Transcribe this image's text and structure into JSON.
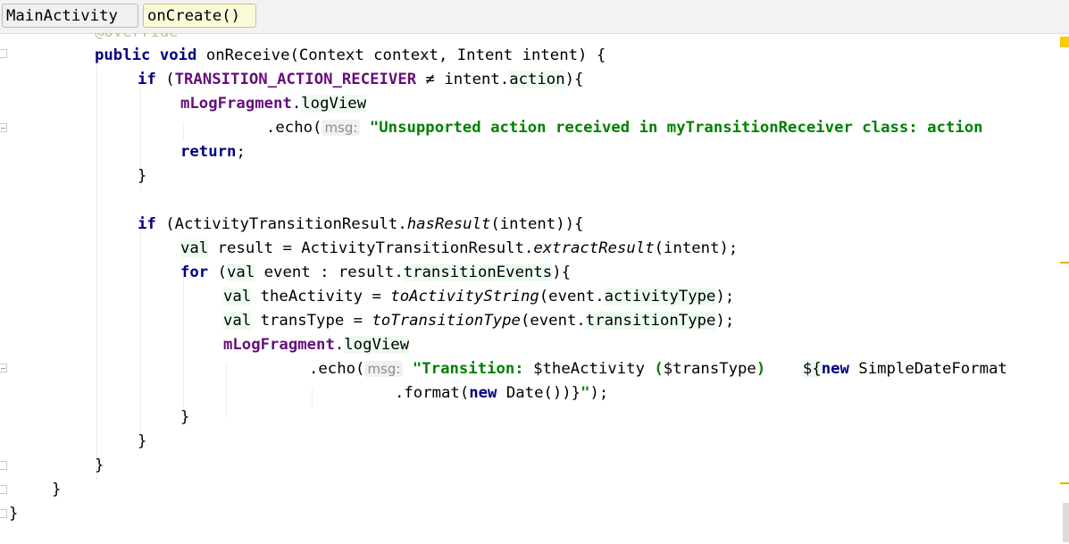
{
  "breadcrumb": {
    "items": [
      {
        "label": "MainActivity"
      },
      {
        "label": "onCreate()"
      }
    ]
  },
  "editor": {
    "override_text": "@Override",
    "lines": {
      "l1": {
        "kw1": "public void",
        "rest": " onReceive(Context context, Intent intent) {"
      },
      "l2": {
        "kw": "if",
        "a": " (",
        "field": "TRANSITION_ACTION_RECEIVER",
        "b": " ≠ intent.",
        "prop": "action",
        "c": "){"
      },
      "l3": {
        "field": "mLogFragment",
        "dot": ".",
        "prop": "logView"
      },
      "l4": {
        "a": ".echo(",
        "hint": "msg:",
        "str": "\"Unsupported action received in myTransitionReceiver class: action"
      },
      "l5": {
        "kw": "return",
        "semi": ";"
      },
      "l6": {
        "text": "}"
      },
      "l8": {
        "kw": "if",
        "a": " (ActivityTransitionResult.",
        "fn": "hasResult",
        "b": "(intent)){"
      },
      "l9": {
        "kw": "val",
        "a": " result = ActivityTransitionResult.",
        "fn": "extractResult",
        "b": "(intent);"
      },
      "l10": {
        "kw": "for",
        "a": " (",
        "kw2": "val",
        "b": " event : result.",
        "prop": "transitionEvents",
        "c": "){"
      },
      "l11": {
        "kw": "val",
        "a": " theActivity = ",
        "fn": "toActivityString",
        "b": "(event.",
        "prop": "activityType",
        "c": ");"
      },
      "l12": {
        "kw": "val",
        "a": " transType = ",
        "fn": "toTransitionType",
        "b": "(event.",
        "prop": "transitionType",
        "c": ");"
      },
      "l13": {
        "field": "mLogFragment",
        "dot": ".",
        "prop": "logView"
      },
      "l14": {
        "a": ".echo(",
        "hint": "msg:",
        "str": "\"Transition: ",
        "tmpl1": "$theActivity",
        "str2": " (",
        "tmpl2": "$transType",
        "str3": ")    ",
        "tmpl3": "${",
        "kw": "new",
        "rest": " SimpleDateFormat"
      },
      "l15": {
        "a": ".format(",
        "kw": "new",
        "b": " Date())}",
        "str": "\"",
        "c": ");"
      },
      "l16": {
        "text": "}"
      },
      "l17": {
        "text": "}"
      },
      "l18": {
        "text": "}"
      },
      "l19": {
        "text": "}"
      },
      "l20": {
        "text": "}"
      }
    }
  },
  "colors": {
    "keyword": "#000080",
    "field": "#660e7a",
    "string": "#008000",
    "breadcrumb_active": "#fcfbd9",
    "warning_stripe": "#e6b400"
  }
}
